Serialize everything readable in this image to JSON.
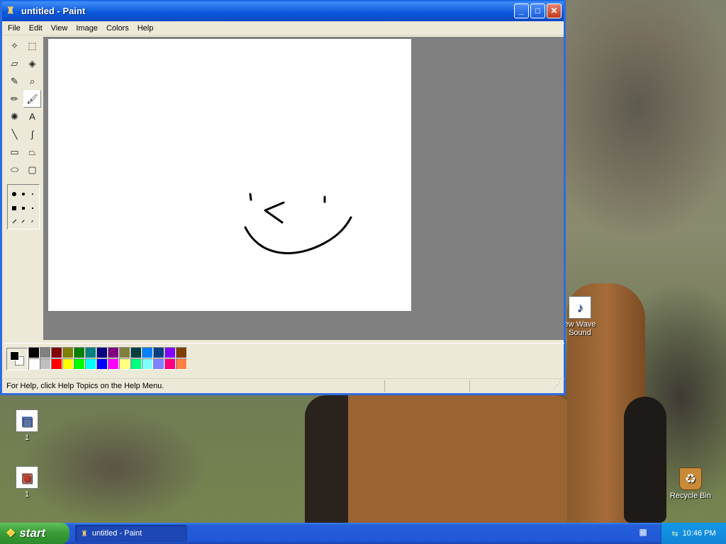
{
  "window": {
    "title": "untitled - Paint",
    "minimize": "_",
    "maximize": "□",
    "close": "✕"
  },
  "menu": [
    "File",
    "Edit",
    "View",
    "Image",
    "Colors",
    "Help"
  ],
  "tools": [
    {
      "name": "free-form-select-icon",
      "glyph": "✧"
    },
    {
      "name": "select-icon",
      "glyph": "⬚"
    },
    {
      "name": "eraser-icon",
      "glyph": "▱"
    },
    {
      "name": "fill-icon",
      "glyph": "◈"
    },
    {
      "name": "pick-color-icon",
      "glyph": "✎"
    },
    {
      "name": "magnifier-icon",
      "glyph": "⌕"
    },
    {
      "name": "pencil-icon",
      "glyph": "✏"
    },
    {
      "name": "brush-icon",
      "glyph": "🖌"
    },
    {
      "name": "airbrush-icon",
      "glyph": "✺"
    },
    {
      "name": "text-icon",
      "glyph": "A"
    },
    {
      "name": "line-icon",
      "glyph": "╲"
    },
    {
      "name": "curve-icon",
      "glyph": "∫"
    },
    {
      "name": "rectangle-icon",
      "glyph": "▭"
    },
    {
      "name": "polygon-icon",
      "glyph": "⏢"
    },
    {
      "name": "ellipse-icon",
      "glyph": "⬭"
    },
    {
      "name": "rounded-rectangle-icon",
      "glyph": "▢"
    }
  ],
  "active_tool": "brush-icon",
  "palette": {
    "top": [
      "#000000",
      "#808080",
      "#800000",
      "#808000",
      "#008000",
      "#008080",
      "#000080",
      "#800080",
      "#808040",
      "#004040",
      "#0080ff",
      "#004080",
      "#8000ff",
      "#804000"
    ],
    "bottom": [
      "#ffffff",
      "#c0c0c0",
      "#ff0000",
      "#ffff00",
      "#00ff00",
      "#00ffff",
      "#0000ff",
      "#ff00ff",
      "#ffff80",
      "#00ff80",
      "#80ffff",
      "#8080ff",
      "#ff0080",
      "#ff8040"
    ],
    "foreground": "#000000",
    "background": "#ffffff"
  },
  "status": {
    "text": "For Help, click Help Topics on the Help Menu."
  },
  "desktop_icons": {
    "wave_sound": "ew Wave\nSound",
    "wave_glyph": "♪",
    "doc1_label": "1",
    "doc1_glyph": "▤",
    "doc2_label": "1",
    "doc2_glyph": "▣",
    "recycle_bin": "Recycle Bin",
    "recycle_glyph": "♻"
  },
  "taskbar": {
    "start": "start",
    "start_glyph": "❖",
    "task_label": "untitled - Paint",
    "task_glyph": "♜",
    "lang_glyph": "▦",
    "net_glyph": "⇆",
    "clock": "10:46 PM"
  }
}
